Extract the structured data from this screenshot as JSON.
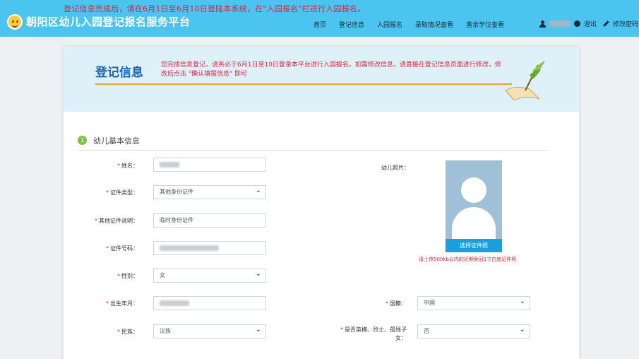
{
  "header": {
    "notice": "登记信息完成后，请在6月1日至6月10日登陆本系统，在\"入园报名\"栏进行入园报名。",
    "site_title": "朝阳区幼儿入园登记报名服务平台",
    "nav": [
      "首页",
      "登记信息",
      "入园报名",
      "录取情况查看",
      "富余学位查看"
    ],
    "logout_label": "退出",
    "change_password_label": "修改密码"
  },
  "page": {
    "title": "登记信息",
    "note": "您完成信息登记，请务必于6月1日至10日登录本平台进行入园报名。如需修改信息，请直接在登记信息页面进行修改，修改后点击 \"确认填报信息\" 即可"
  },
  "section": {
    "number": "1",
    "title": "幼儿基本信息"
  },
  "form": {
    "name_label": "姓名：",
    "id_type_label": "证件类型：",
    "id_type_value": "其他身份证件",
    "other_id_desc_label": "其他证件说明：",
    "other_id_desc_value": "临时身份证件",
    "id_number_label": "证件号码：",
    "gender_label": "性别：",
    "gender_value": "女",
    "birth_label": "出生年月：",
    "ethnicity_label": "民族：",
    "ethnicity_value": "汉族",
    "photo_label": "幼儿照片：",
    "photo_button": "选择证件照",
    "photo_hint": "请上传500kb以内的近期免冠1寸白底证件照",
    "nationality_label": "国籍：",
    "nationality_value": "中国",
    "martyr_label_line1": "是否英模、烈士、孤残子",
    "martyr_label_line2": "女：",
    "martyr_value": "否",
    "required_mark": "*"
  },
  "colors": {
    "topbar": "#4cc4f0",
    "accent_red": "#e0213a",
    "title_blue": "#1e64b4",
    "underline_orange": "#f0a030",
    "photo_button": "#1aa0dc"
  }
}
